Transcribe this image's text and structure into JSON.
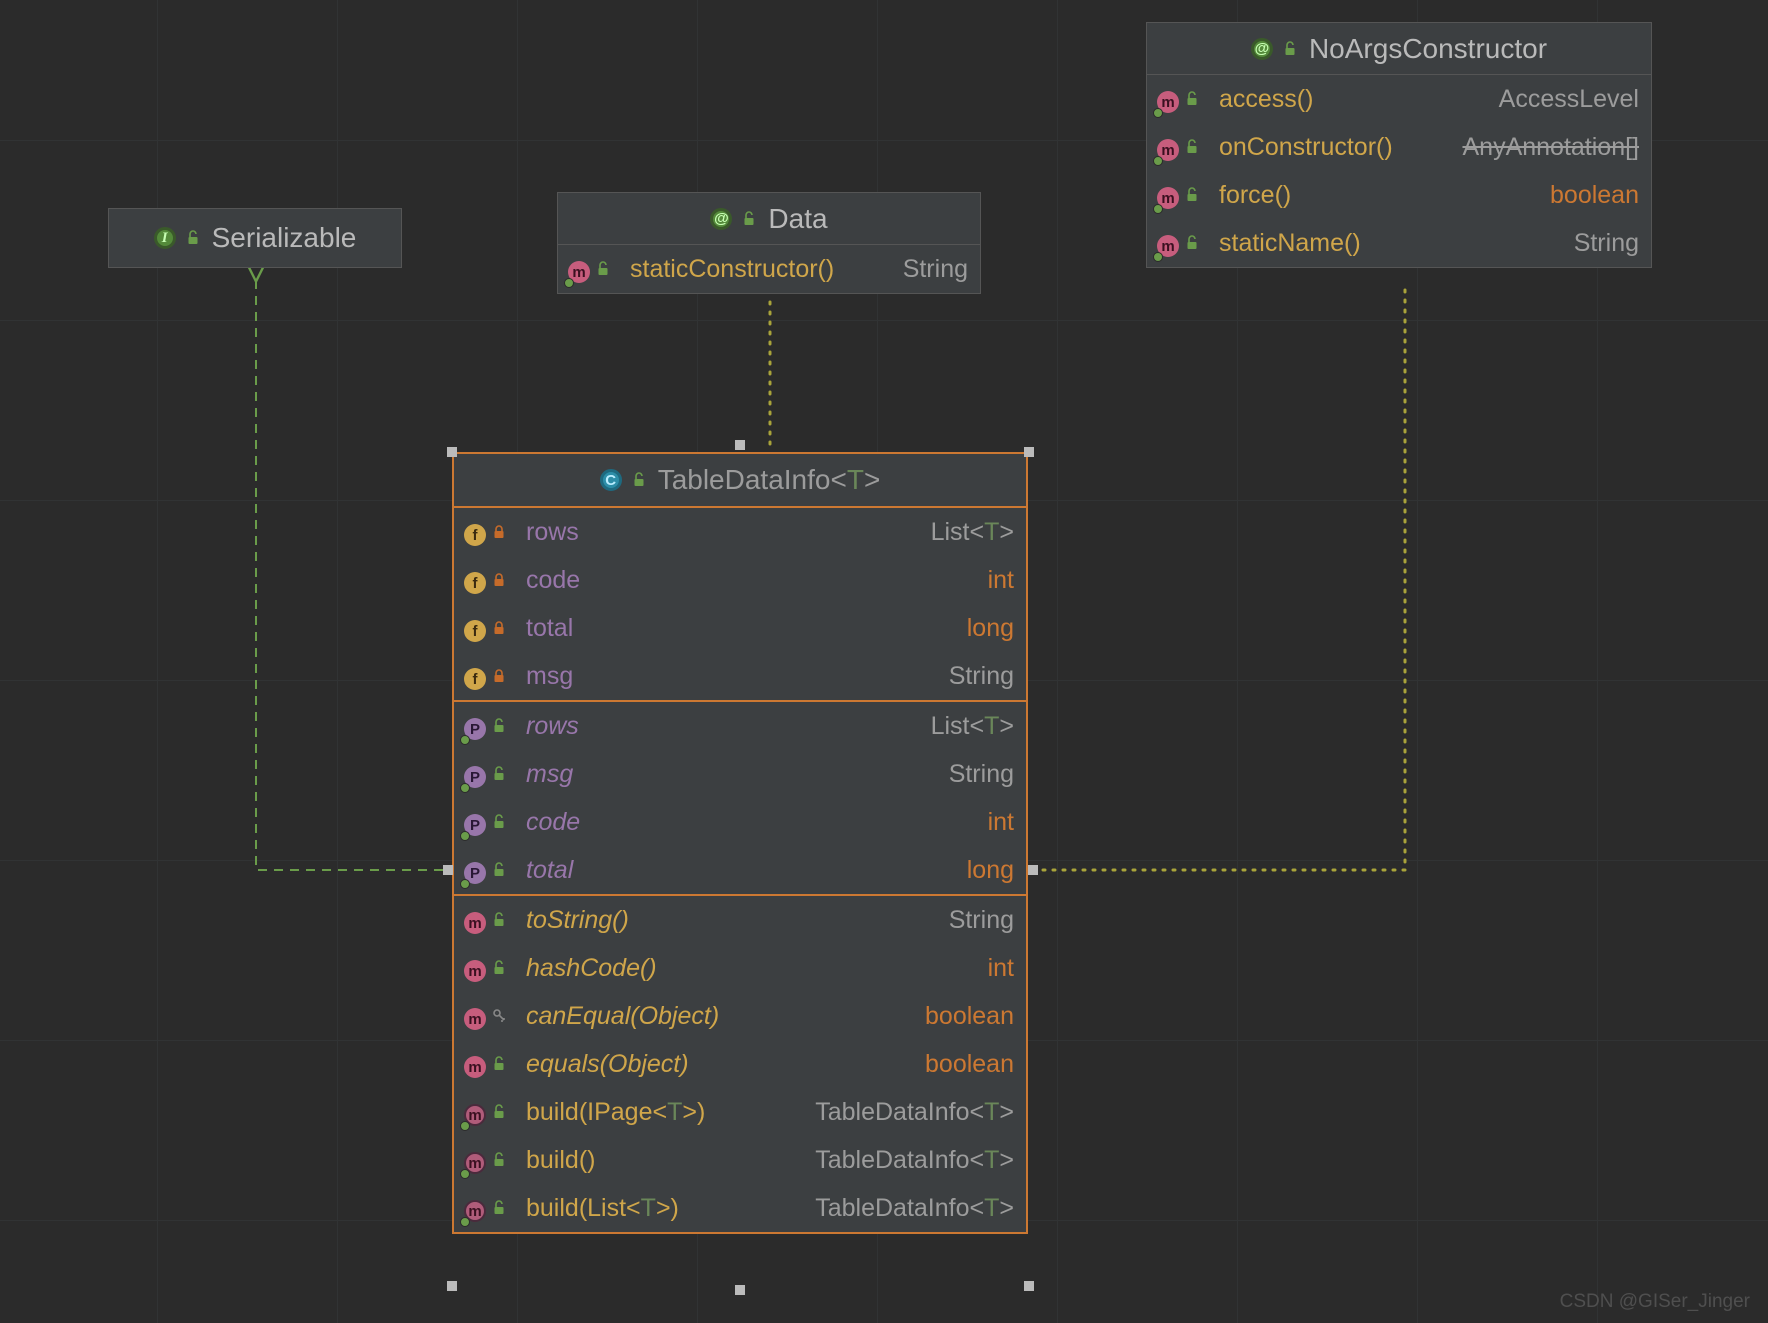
{
  "watermark": "CSDN @GISer_Jinger",
  "colors": {
    "accent": "#cc7832",
    "select": "#cc7832"
  },
  "boxes": {
    "serializable": {
      "title": "Serializable",
      "kind": "I"
    },
    "data": {
      "title": "Data",
      "kind": "@",
      "members": [
        {
          "icon": "m",
          "hook": true,
          "mod": "unlock",
          "name": "staticConstructor()",
          "style": "yellow",
          "type": "String",
          "typeStyle": "gray"
        }
      ]
    },
    "noargs": {
      "title": "NoArgsConstructor",
      "kind": "@",
      "members": [
        {
          "icon": "m",
          "hook": true,
          "mod": "unlock",
          "name": "access()",
          "style": "yellow",
          "type": "AccessLevel",
          "typeStyle": "gray"
        },
        {
          "icon": "m",
          "hook": true,
          "mod": "unlock",
          "name": "onConstructor()",
          "style": "yellow",
          "type": "AnyAnnotation[]",
          "typeStyle": "gray strike"
        },
        {
          "icon": "m",
          "hook": true,
          "mod": "unlock",
          "name": "force()",
          "style": "yellow",
          "type": "boolean",
          "typeStyle": "orange"
        },
        {
          "icon": "m",
          "hook": true,
          "mod": "unlock",
          "name": "staticName()",
          "style": "yellow",
          "type": "String",
          "typeStyle": "gray"
        }
      ]
    },
    "table": {
      "title": "TableDataInfo<T>",
      "kind": "C",
      "sections": [
        [
          {
            "icon": "f",
            "mod": "lock",
            "name": "rows",
            "style": "purple",
            "type": "List<T>",
            "typeSpecial": "listT"
          },
          {
            "icon": "f",
            "mod": "lock",
            "name": "code",
            "style": "purple",
            "type": "int",
            "typeStyle": "orange"
          },
          {
            "icon": "f",
            "mod": "lock",
            "name": "total",
            "style": "purple",
            "type": "long",
            "typeStyle": "orange"
          },
          {
            "icon": "f",
            "mod": "lock",
            "name": "msg",
            "style": "purple",
            "type": "String",
            "typeStyle": "gray"
          }
        ],
        [
          {
            "icon": "p",
            "hook": true,
            "mod": "unlock",
            "name": "rows",
            "style": "purple italic",
            "type": "List<T>",
            "typeSpecial": "listT"
          },
          {
            "icon": "p",
            "hook": true,
            "mod": "unlock",
            "name": "msg",
            "style": "purple italic",
            "type": "String",
            "typeStyle": "gray"
          },
          {
            "icon": "p",
            "hook": true,
            "mod": "unlock",
            "name": "code",
            "style": "purple italic",
            "type": "int",
            "typeStyle": "orange"
          },
          {
            "icon": "p",
            "hook": true,
            "mod": "unlock",
            "name": "total",
            "style": "purple italic",
            "type": "long",
            "typeStyle": "orange"
          }
        ],
        [
          {
            "icon": "m",
            "mod": "unlock",
            "name": "toString()",
            "style": "yellow italic",
            "type": "String",
            "typeStyle": "gray"
          },
          {
            "icon": "m",
            "mod": "unlock",
            "name": "hashCode()",
            "style": "yellow italic",
            "type": "int",
            "typeStyle": "orange"
          },
          {
            "icon": "m",
            "mod": "key",
            "name": "canEqual(Object)",
            "style": "yellow italic",
            "type": "boolean",
            "typeStyle": "orange"
          },
          {
            "icon": "m",
            "mod": "unlock",
            "name": "equals(Object)",
            "style": "yellow italic",
            "type": "boolean",
            "typeStyle": "orange"
          },
          {
            "icon": "m2",
            "hook": true,
            "mod": "unlock",
            "name": "build(IPage<T>)",
            "style": "yellow",
            "type": "TableDataInfo<T>",
            "typeSpecial": "tdiT"
          },
          {
            "icon": "m2",
            "hook": true,
            "mod": "unlock",
            "name": "build()",
            "style": "yellow",
            "type": "TableDataInfo<T>",
            "typeSpecial": "tdiT"
          },
          {
            "icon": "m2",
            "hook": true,
            "mod": "unlock",
            "name": "build(List<T>)",
            "style": "yellow",
            "type": "TableDataInfo<T>",
            "typeSpecial": "tdiT"
          }
        ]
      ]
    }
  }
}
